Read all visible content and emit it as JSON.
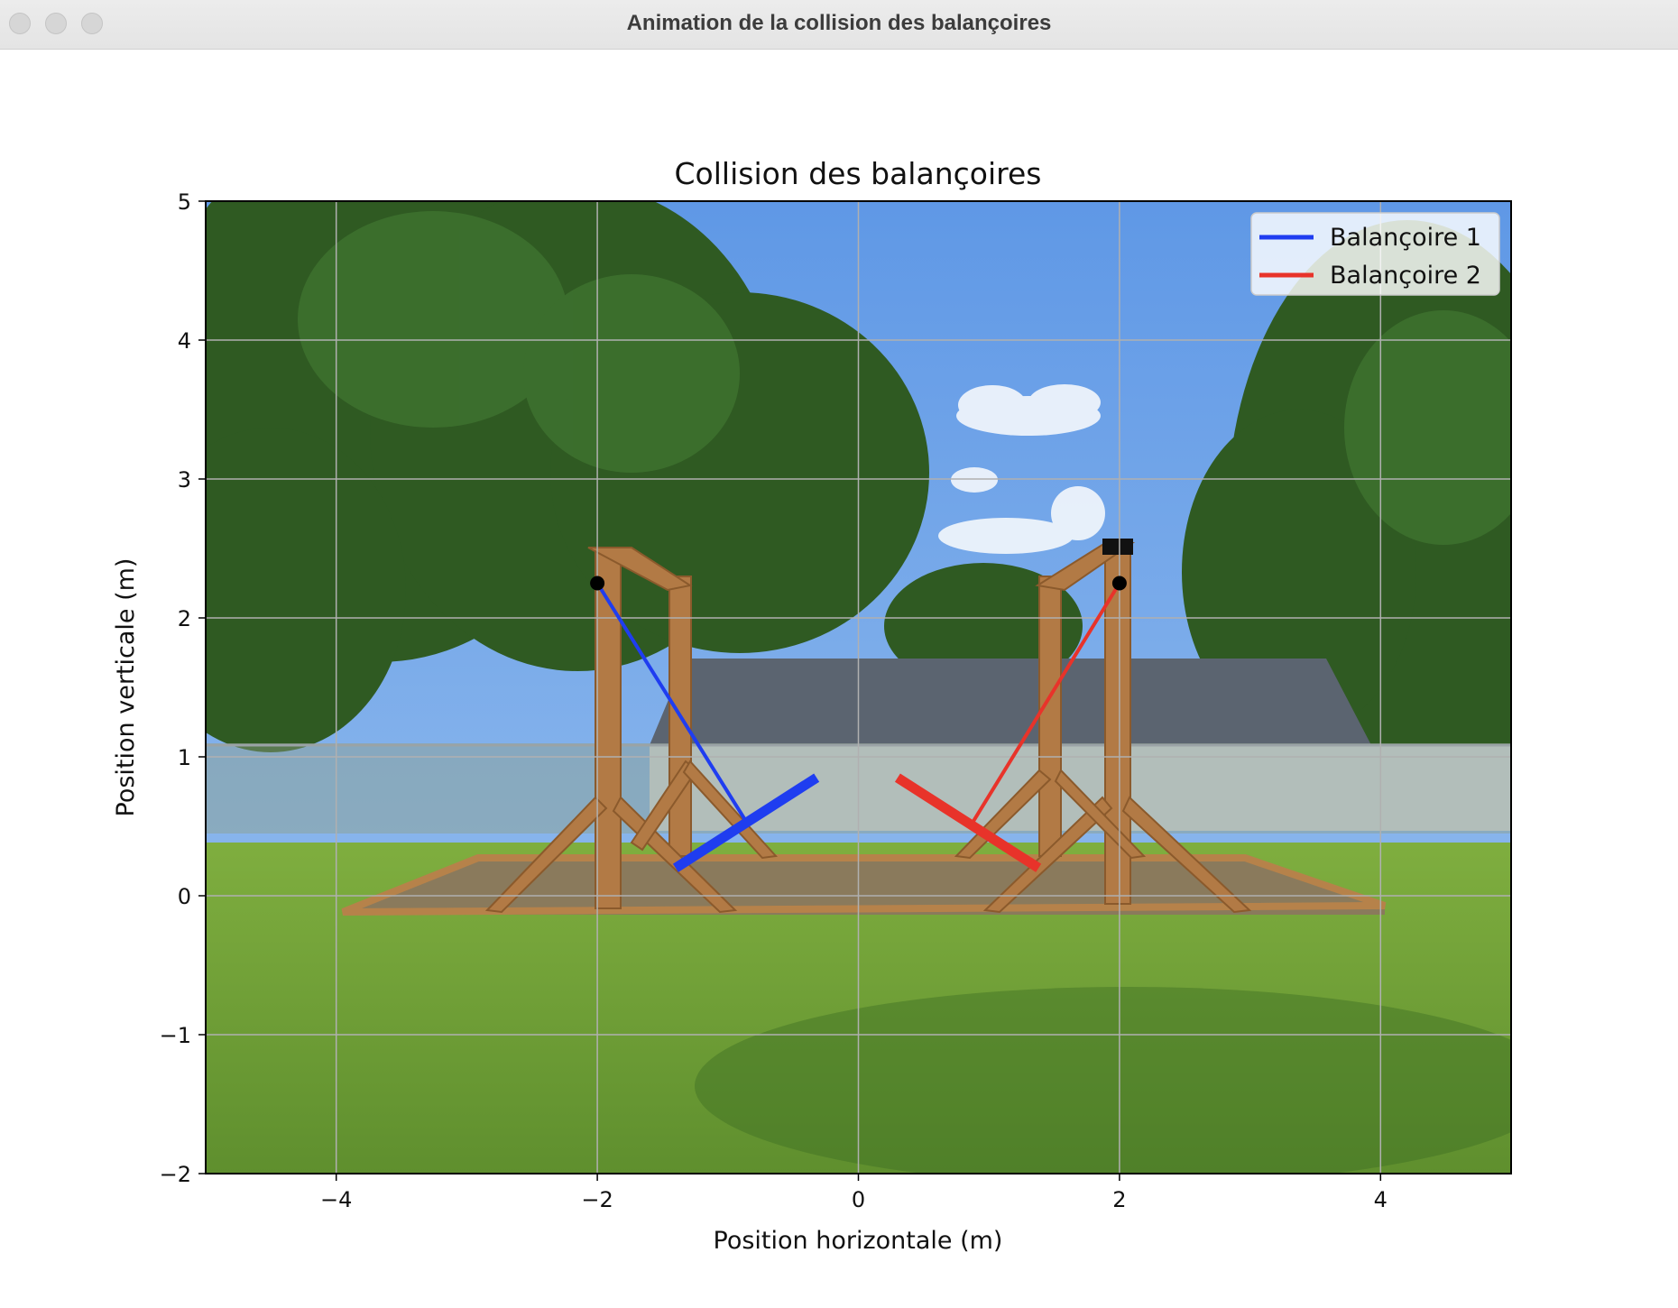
{
  "window": {
    "title": "Animation de la collision des balançoires"
  },
  "chart_data": {
    "type": "line",
    "title": "Collision des balançoires",
    "xlabel": "Position horizontale (m)",
    "ylabel": "Position verticale (m)",
    "xlim": [
      -5,
      5
    ],
    "ylim": [
      -2,
      5
    ],
    "xticks": [
      -4,
      -2,
      0,
      2,
      4
    ],
    "xtick_labels": [
      "−4",
      "−2",
      "0",
      "2",
      "4"
    ],
    "yticks": [
      -2,
      -1,
      0,
      1,
      2,
      3,
      4,
      5
    ],
    "ytick_labels": [
      "−2",
      "−1",
      "0",
      "1",
      "2",
      "3",
      "4",
      "5"
    ],
    "grid": true,
    "legend_position": "top-right",
    "background_image": "photograph of two wooden swing frames on grass under trees and blue sky",
    "series": [
      {
        "name": "Balançoire 1",
        "color": "#1f3df0",
        "pivot": [
          -2.0,
          2.25
        ],
        "rope_end": [
          -0.87,
          0.55
        ],
        "seat": [
          [
            -1.4,
            0.2
          ],
          [
            -0.32,
            0.85
          ]
        ]
      },
      {
        "name": "Balançoire 2",
        "color": "#e8332a",
        "pivot": [
          2.0,
          2.25
        ],
        "rope_end": [
          0.87,
          0.52
        ],
        "seat": [
          [
            0.3,
            0.85
          ],
          [
            1.38,
            0.2
          ]
        ]
      }
    ]
  }
}
